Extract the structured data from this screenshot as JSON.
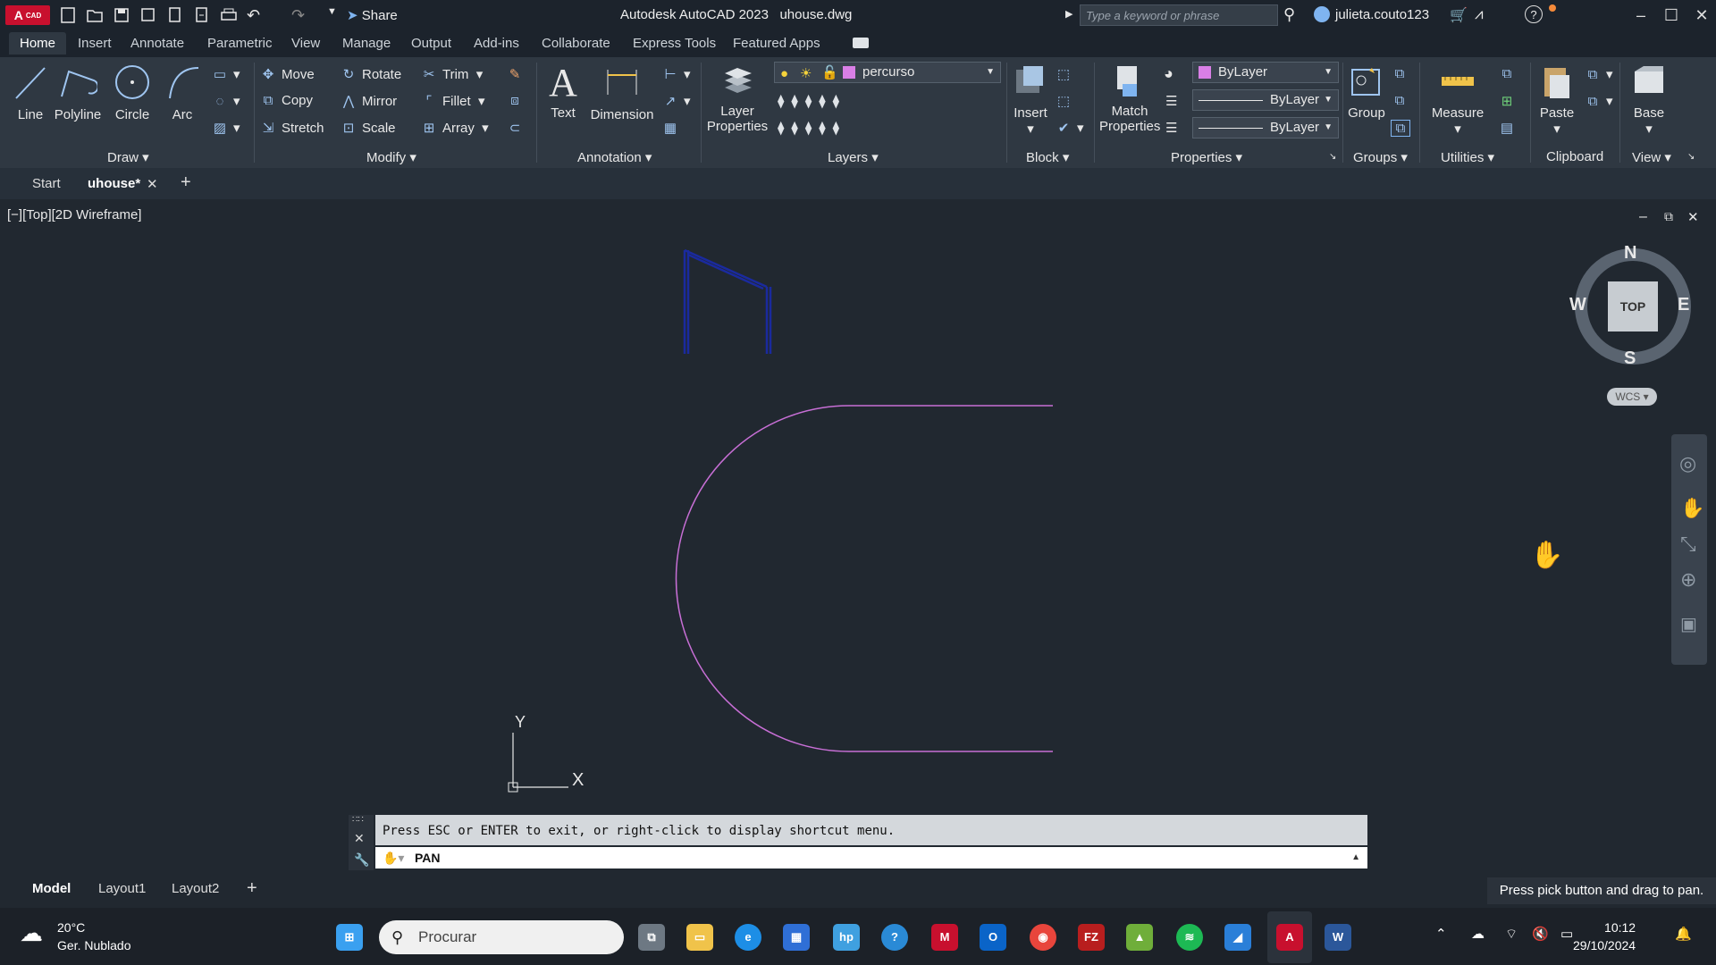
{
  "app": {
    "title": "Autodesk AutoCAD 2023",
    "filename": "uhouse.dwg",
    "logo_text": "A",
    "logo_sub": "CAD",
    "share_label": "Share",
    "search_placeholder": "Type a keyword or phrase",
    "user": "julieta.couto123"
  },
  "ribbon_tabs": [
    "Home",
    "Insert",
    "Annotate",
    "Parametric",
    "View",
    "Manage",
    "Output",
    "Add-ins",
    "Collaborate",
    "Express Tools",
    "Featured Apps"
  ],
  "draw": {
    "line": "Line",
    "polyline": "Polyline",
    "circle": "Circle",
    "arc": "Arc",
    "panel": "Draw"
  },
  "modify": {
    "move": "Move",
    "rotate": "Rotate",
    "trim": "Trim",
    "copy": "Copy",
    "mirror": "Mirror",
    "fillet": "Fillet",
    "stretch": "Stretch",
    "scale": "Scale",
    "array": "Array",
    "panel": "Modify"
  },
  "annotation": {
    "text": "Text",
    "dimension": "Dimension",
    "panel": "Annotation"
  },
  "layers": {
    "layer_properties_1": "Layer",
    "layer_properties_2": "Properties",
    "current_layer": "percurso",
    "panel": "Layers"
  },
  "block": {
    "insert": "Insert",
    "panel": "Block"
  },
  "properties": {
    "match_1": "Match",
    "match_2": "Properties",
    "color": "ByLayer",
    "linetype": "ByLayer",
    "lineweight": "ByLayer",
    "panel": "Properties"
  },
  "groups": {
    "group": "Group",
    "panel": "Groups"
  },
  "utilities": {
    "measure": "Measure",
    "panel": "Utilities"
  },
  "clipboard": {
    "paste": "Paste",
    "panel": "Clipboard"
  },
  "view": {
    "base": "Base",
    "panel": "View"
  },
  "file_tabs": {
    "start": "Start",
    "current": "uhouse*"
  },
  "viewport": {
    "label": "[−][Top][2D Wireframe]",
    "compass_n": "N",
    "compass_s": "S",
    "compass_e": "E",
    "compass_w": "W",
    "cube_face": "TOP",
    "wcs": "WCS",
    "ucs_x": "X",
    "ucs_y": "Y"
  },
  "command": {
    "history": "Press ESC or ENTER to exit, or right-click to display shortcut menu.",
    "input": "PAN"
  },
  "layout_tabs": [
    "Model",
    "Layout1",
    "Layout2"
  ],
  "status_message": "Press pick button and drag to pan.",
  "taskbar": {
    "temperature": "20°C",
    "weather": "Ger. Nublado",
    "search": "Procurar",
    "time": "10:12",
    "date": "29/10/2024"
  },
  "colors": {
    "layer_swatch": "#d97fe6",
    "arc_color": "#c86fd6",
    "blue_lines": "#1a2a9e",
    "autocad_red": "#c8102e"
  }
}
